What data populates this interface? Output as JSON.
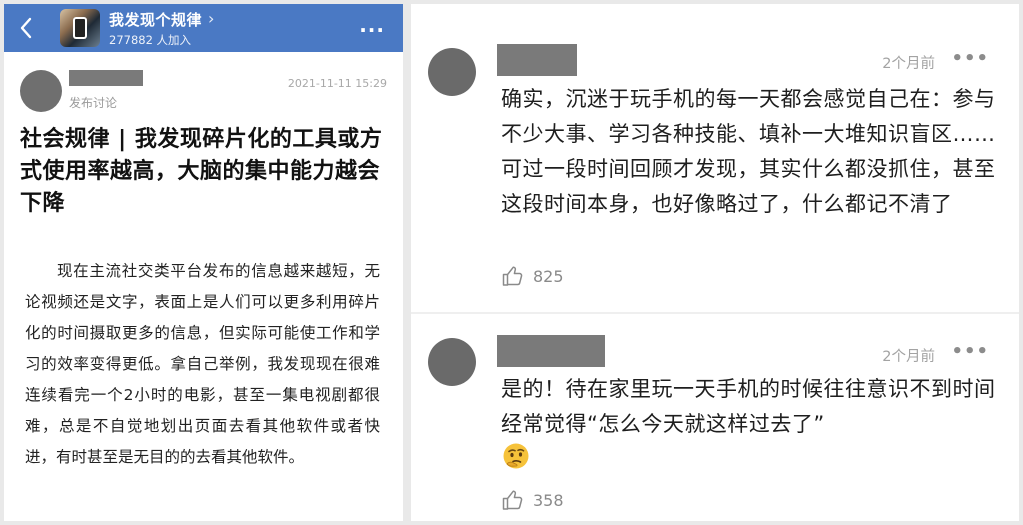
{
  "group": {
    "name": "我发现个规律",
    "members": "277882 人加入"
  },
  "post": {
    "tag": "发布讨论",
    "time": "2021-11-11 15:29",
    "title": "社会规律 | 我发现碎片化的工具或方式使用率越高，大脑的集中能力越会下降",
    "body": "现在主流社交类平台发布的信息越来越短，无论视频还是文字，表面上是人们可以更多利用碎片化的时间摄取更多的信息，但实际可能使工作和学习的效率变得更低。拿自己举例，我发现现在很难连续看完一个2小时的电影，甚至一集电视剧都很难，总是不自觉地划出页面去看其他软件或者快进，有时甚至是无目的的去看其他软件。"
  },
  "comments": [
    {
      "time": "2个月前",
      "text": "确实，沉迷于玩手机的每一天都会感觉自己在：参与不少大事、学习各种技能、填补一大堆知识盲区……可过一段时间回顾才发现，其实什么都没抓住，甚至这段时间本身，也好像略过了，什么都记不清了",
      "likes": "825"
    },
    {
      "time": "2个月前",
      "text": "是的！待在家里玩一天手机的时候往往意识不到时间 经常觉得“怎么今天就这样过去了”",
      "emoji": "thinking-face-icon",
      "likes": "358"
    }
  ]
}
